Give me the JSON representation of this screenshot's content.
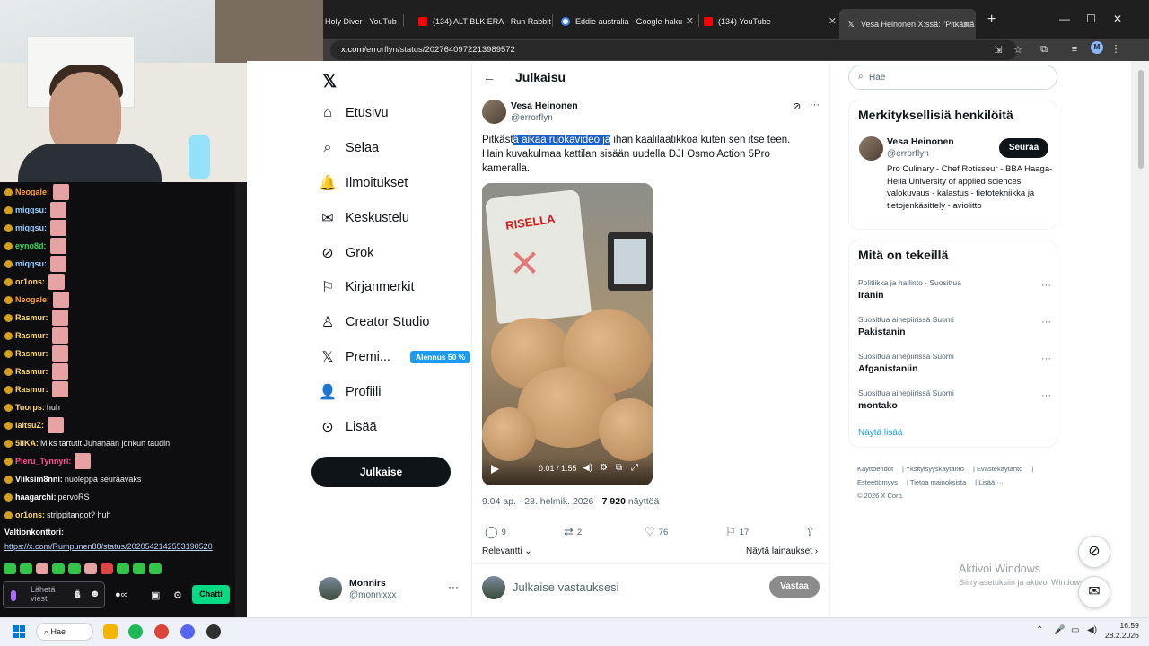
{
  "browser": {
    "tabs": [
      {
        "label": "Holy Diver - YouTub",
        "icon": "youtube-icon"
      },
      {
        "label": "(134) ALT BLK ERA - Run Rabbit",
        "icon": "youtube-icon"
      },
      {
        "label": "Eddie australia - Google-haku",
        "icon": "google-icon"
      },
      {
        "label": "(134) YouTube",
        "icon": "youtube-icon"
      },
      {
        "label": "Vesa Heinonen X:ssä: \"Pitkästä a",
        "icon": "x-icon"
      }
    ],
    "url_domain": "x.com",
    "url_path": "/errorflyn/status/2027640972213989572",
    "profile_initial": "M"
  },
  "chat": {
    "messages": [
      {
        "user": "Neogale:",
        "text": "",
        "color": "#ff9f2e",
        "emote": true
      },
      {
        "user": "miqqsu:",
        "text": "",
        "color": "#8ecaff",
        "emote": true
      },
      {
        "user": "miqqsu:",
        "text": "",
        "color": "#8ecaff",
        "emote": true
      },
      {
        "user": "eyno8d:",
        "text": "",
        "color": "#36d95a",
        "emote": true
      },
      {
        "user": "miqqsu:",
        "text": "",
        "color": "#8ecaff",
        "emote": true
      },
      {
        "user": "or1ons:",
        "text": "",
        "color": "#ffd76b",
        "emote": true
      },
      {
        "user": "Neogale:",
        "text": "",
        "color": "#ff9f2e",
        "emote": true
      },
      {
        "user": "Rasmur:",
        "text": "",
        "color": "#ffd76b",
        "emote": true
      },
      {
        "user": "Rasmur:",
        "text": "",
        "color": "#ffd76b",
        "emote": true
      },
      {
        "user": "Rasmur:",
        "text": "",
        "color": "#ffd76b",
        "emote": true
      },
      {
        "user": "Rasmur:",
        "text": "",
        "color": "#ffd76b",
        "emote": true
      },
      {
        "user": "Rasmur:",
        "text": "",
        "color": "#ffd76b",
        "emote": true
      },
      {
        "user": "Tuorps:",
        "text": "huh",
        "color": "#ffd76b",
        "emote": false
      },
      {
        "user": "laitsuZ:",
        "text": "",
        "color": "#ffd76b",
        "emote": true
      },
      {
        "user": "5IIKA:",
        "text": "Miks tartutit Juhanaan jonkun taudin",
        "color": "#ffd76b",
        "emote": false
      },
      {
        "user": "Pieru_Tynnyri:",
        "text": "",
        "color": "#ff4f9a",
        "emote": true
      },
      {
        "user": "Viiksim8nni:",
        "text": "nuoleppa seuraavaks",
        "color": "#ffffff",
        "emote": false
      },
      {
        "user": "haagarchi:",
        "text": "pervoRS",
        "color": "#ffffff",
        "emote": false
      },
      {
        "user": "or1ons:",
        "text": "strippitangot? huh",
        "color": "#ffd76b",
        "emote": false
      },
      {
        "user": "Valtionkonttori:",
        "text": "",
        "color": "#ffffff",
        "emote": false
      }
    ],
    "link": "https://x.com/Rumpunen88/status/2020542142553190520",
    "input_placeholder_1": "Lähetä",
    "input_placeholder_2": "viesti",
    "send_label": "Chatti"
  },
  "nav": {
    "items": [
      {
        "label": "Etusivu",
        "icon": "home-icon"
      },
      {
        "label": "Selaa",
        "icon": "search-icon"
      },
      {
        "label": "Ilmoitukset",
        "icon": "bell-icon"
      },
      {
        "label": "Keskustelu",
        "icon": "mail-icon"
      },
      {
        "label": "Grok",
        "icon": "grok-icon"
      },
      {
        "label": "Kirjanmerkit",
        "icon": "bookmark-icon"
      },
      {
        "label": "Creator Studio",
        "icon": "creator-icon"
      },
      {
        "label": "Premi...",
        "icon": "x-icon"
      },
      {
        "label": "Profiili",
        "icon": "person-icon"
      },
      {
        "label": "Lisää",
        "icon": "more-icon"
      }
    ],
    "premium_badge": "Alennus 50 %",
    "post_button": "Julkaise",
    "account_name": "Monnirs",
    "account_handle": "@monnixxx"
  },
  "post": {
    "header_title": "Julkaisu",
    "author_name": "Vesa Heinonen",
    "author_handle": "@errorflyn",
    "text_before": "Pitkäst",
    "text_highlight": "ä aikaa ruokavideo ja",
    "text_after": " ihan kaalilaatikkoa kuten sen itse teen. Hain kuvakulmaa kattilan sisään uudella DJI Osmo Action 5Pro kameralla.",
    "video_time": "0:01 / 1:55",
    "video_bag_text": "RISELLA",
    "meta_date": "9.04 ap. · 28. helmik. 2026 · ",
    "meta_views_count": "7 920",
    "meta_views_label": " näyttöä",
    "replies": "9",
    "reposts": "2",
    "likes": "76",
    "bookmarks": "17",
    "sort_label": "Relevantti",
    "quotes_label": "Näytä lainaukset",
    "reply_placeholder": "Julkaise vastauksesi",
    "reply_button": "Vastaa"
  },
  "sidebar": {
    "search_placeholder": "Hae",
    "people_title": "Merkityksellisiä henkilöitä",
    "person_name": "Vesa Heinonen",
    "person_handle": "@errorflyn",
    "follow_label": "Seuraa",
    "person_bio": "Pro Culinary - Chef Rotisseur - BBA Haaga-Helia University of applied sciences valokuvaus - kalastus - tietotekniikka ja tietojenkäsittely - aviolitto",
    "trends_title": "Mitä on tekeillä",
    "trends": [
      {
        "context": "Politiikka ja hallinto · Suosittua",
        "title": "Iranin"
      },
      {
        "context": "Suosittua aihepiirissä Suomi",
        "title": "Pakistanin"
      },
      {
        "context": "Suosittua aihepiirissä Suomi",
        "title": "Afganistaniin"
      },
      {
        "context": "Suosittua aihepiirissä Suomi",
        "title": "montako"
      }
    ],
    "show_more": "Näytä lisää",
    "footer_links": [
      "Käyttöehdot",
      "Yksityisyyskäytäntö",
      "Evästekäytäntö",
      "Esteettömyys",
      "Tietoa mainoksista",
      "Lisää ···"
    ],
    "copyright": "© 2026 X Corp."
  },
  "windows": {
    "activate_title": "Aktivoi Windows",
    "activate_sub": "Siirry asetuksiin ja aktivoi Windows.",
    "search_label": "Hae",
    "time": "16.59",
    "date": "28.2.2026"
  },
  "colors": {
    "x_blue": "#1d9bf0",
    "text_dark": "#0f1419",
    "text_muted": "#536471",
    "highlight": "#1a5fce",
    "twitch_green": "#00db84"
  }
}
